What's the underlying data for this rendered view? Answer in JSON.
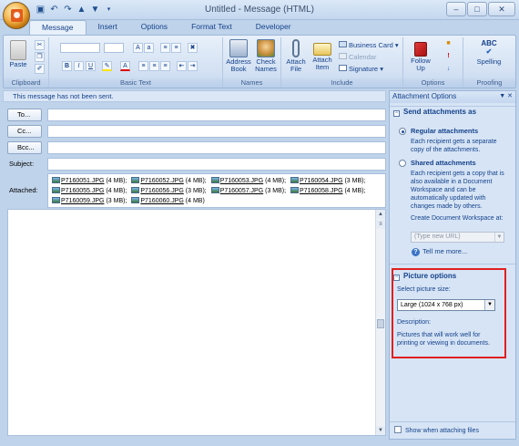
{
  "window": {
    "title": "Untitled - Message (HTML)",
    "qat": [
      "save",
      "undo",
      "redo",
      "prev",
      "next",
      "more"
    ],
    "controls": [
      "–",
      "□",
      "✕"
    ]
  },
  "tabs": [
    "Message",
    "Insert",
    "Options",
    "Format Text",
    "Developer"
  ],
  "ribbon": {
    "groups": {
      "clipboard": "Clipboard",
      "basic_text": "Basic Text",
      "names": "Names",
      "include": "Include",
      "options": "Options",
      "proofing": "Proofing"
    },
    "paste": "Paste",
    "address_book": [
      "Address",
      "Book"
    ],
    "check_names": [
      "Check",
      "Names"
    ],
    "attach_file": [
      "Attach",
      "File"
    ],
    "attach_item": [
      "Attach",
      "Item"
    ],
    "business_card": "Business Card",
    "calendar": "Calendar",
    "signature": "Signature",
    "follow_up": [
      "Follow",
      "Up"
    ],
    "spelling": "Spelling",
    "format_buttons": [
      "B",
      "I",
      "U"
    ]
  },
  "infobar": "This message has not been sent.",
  "header": {
    "to": "To...",
    "cc": "Cc...",
    "bcc": "Bcc...",
    "subject": "Subject:",
    "attached": "Attached:"
  },
  "attachments": [
    {
      "name": "P7160051.JPG",
      "size": "(4 MB)"
    },
    {
      "name": "P7160052.JPG",
      "size": "(4 MB)"
    },
    {
      "name": "P7160053.JPG",
      "size": "(4 MB)"
    },
    {
      "name": "P7160054.JPG",
      "size": "(3 MB)"
    },
    {
      "name": "P7160055.JPG",
      "size": "(4 MB)"
    },
    {
      "name": "P7160056.JPG",
      "size": "(3 MB)"
    },
    {
      "name": "P7160057.JPG",
      "size": "(3 MB)"
    },
    {
      "name": "P7160058.JPG",
      "size": "(4 MB)"
    },
    {
      "name": "P7160059.JPG",
      "size": "(3 MB)"
    },
    {
      "name": "P7160060.JPG",
      "size": "(4 MB)"
    }
  ],
  "pane": {
    "title": "Attachment Options",
    "send_as_header": "Send attachments as",
    "regular": "Regular attachments",
    "regular_desc": "Each recipient gets a separate copy of the attachments.",
    "shared": "Shared attachments",
    "shared_desc": "Each recipient gets a copy that is also available in a Document Workspace and can be automatically updated with changes made by others.",
    "create_ws": "Create Document Workspace at:",
    "url_placeholder": "(Type new URL)",
    "tell_me": "Tell me more...",
    "picture_header": "Picture options",
    "select_size": "Select picture size:",
    "size_value": "Large (1024 x 768 px)",
    "description_label": "Description:",
    "description": "Pictures that will work well for printing or viewing in documents.",
    "show_when": "Show when attaching files"
  },
  "colors": {
    "accent": "#15428b",
    "ribbon_bg": "#d3e1f3",
    "highlight_box": "#e0201e"
  }
}
